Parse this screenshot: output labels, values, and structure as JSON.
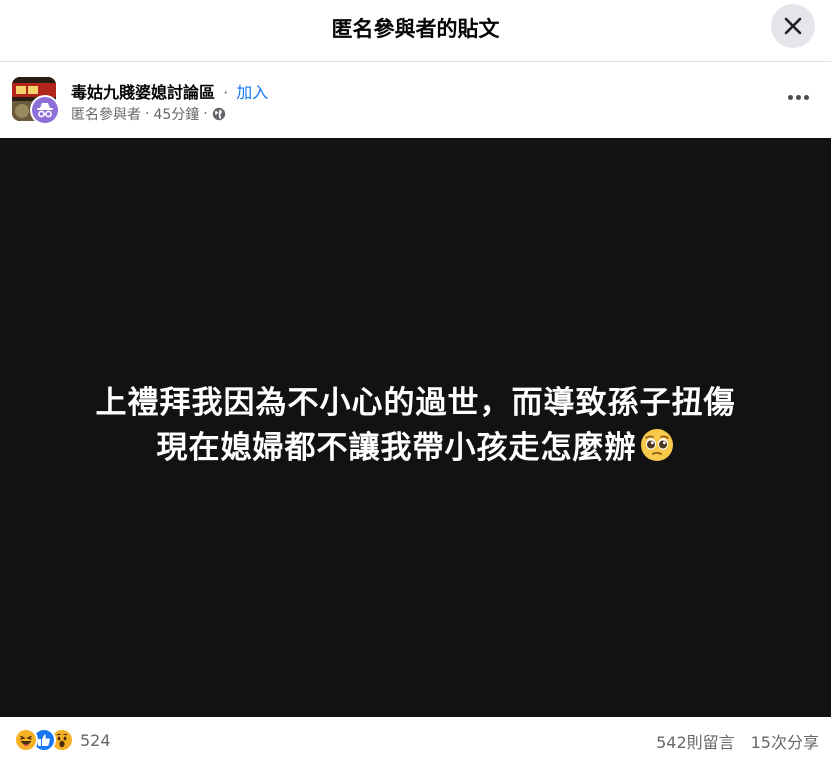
{
  "topbar": {
    "title": "匿名參與者的貼文"
  },
  "header": {
    "group_name": "毒姑九賤婆媳討論區",
    "separator": "·",
    "join_label": "加入",
    "author": "匿名參與者",
    "time": "45分鐘",
    "privacy_icon": "globe-icon"
  },
  "post": {
    "lines": [
      "上禮拜我因為不小心的過世，而導致孫子扭傷",
      "現在媳婦都不讓我帶小孩走怎麼辦"
    ],
    "emoji": "pleading-face-icon",
    "background_color": "#121212"
  },
  "footer": {
    "reactions": [
      "haha-icon",
      "like-icon",
      "wow-icon"
    ],
    "reaction_count": "524",
    "comments": "542則留言",
    "shares": "15次分享"
  },
  "colors": {
    "accent": "#1877f2",
    "muted_text": "#65676b"
  }
}
